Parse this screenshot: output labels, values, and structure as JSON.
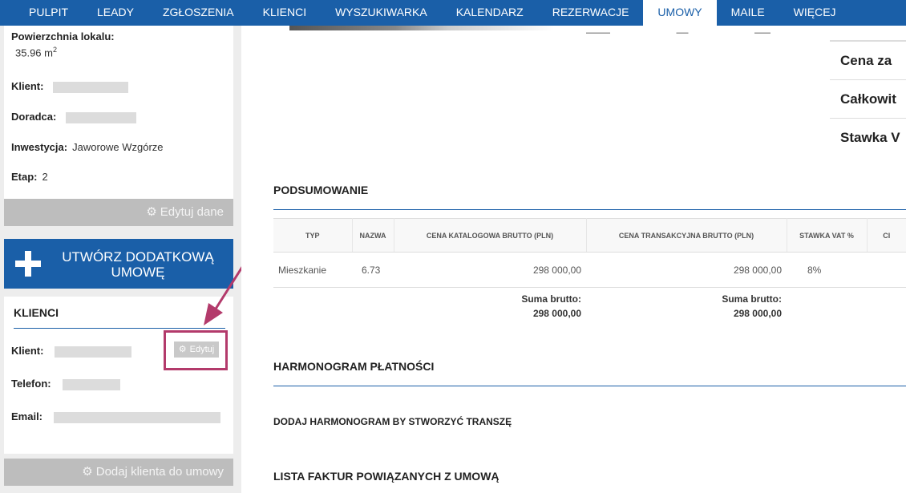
{
  "nav": {
    "items": [
      "PULPIT",
      "LEADY",
      "ZGŁOSZENIA",
      "KLIENCI",
      "WYSZUKIWARKA",
      "KALENDARZ",
      "REZERWACJE",
      "UMOWY",
      "MAILE",
      "WIĘCEJ"
    ],
    "active": "UMOWY"
  },
  "info": {
    "area_label": "Powierzchnia lokalu:",
    "area_value": "35.96 m",
    "area_sup": "2",
    "client_label": "Klient:",
    "advisor_label": "Doradca:",
    "investment_label": "Inwestycja:",
    "investment_value": "Jaworowe Wzgórze",
    "stage_label": "Etap:",
    "stage_value": "2",
    "edit_button": "Edytuj dane"
  },
  "create_contract": {
    "label": "UTWÓRZ DODATKOWĄ UMOWĘ"
  },
  "clients": {
    "title": "KLIENCI",
    "client_label": "Klient:",
    "phone_label": "Telefon:",
    "email_label": "Email:",
    "edit_button": "Edytuj",
    "add_button": "Dodaj klienta do umowy"
  },
  "right_table": {
    "rows": [
      "Cena za",
      "Całkowit",
      "Stawka V"
    ]
  },
  "summary": {
    "title": "PODSUMOWANIE",
    "headers": [
      "TYP",
      "NAZWA",
      "CENA KATALOGOWA BRUTTO (PLN)",
      "CENA TRANSAKCYJNA BRUTTO (PLN)",
      "STAWKA VAT %",
      "CI"
    ],
    "row": {
      "type": "Mieszkanie",
      "name": "6.73",
      "catalog": "298 000,00",
      "transaction": "298 000,00",
      "vat": "8%"
    },
    "sum_label": "Suma brutto:",
    "sum_catalog": "298 000,00",
    "sum_transaction": "298 000,00"
  },
  "schedule": {
    "title": "HARMONOGRAM PŁATNOŚCI",
    "add_text": "DODAJ HARMONOGRAM BY STWORZYĆ TRANSZĘ"
  },
  "invoices": {
    "title": "LISTA FAKTUR POWIĄZANYCH Z UMOWĄ"
  },
  "colors": {
    "brand": "#1a5fa8",
    "highlight": "#b33a6b"
  }
}
